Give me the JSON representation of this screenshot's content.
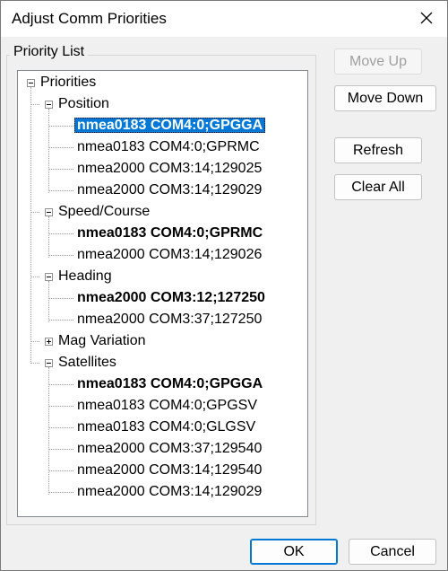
{
  "window": {
    "title": "Adjust Comm Priorities"
  },
  "group": {
    "label": "Priority List"
  },
  "tree": {
    "root": "Priorities",
    "categories": [
      {
        "label": "Position",
        "items": [
          "nmea0183 COM4:0;GPGGA",
          "nmea0183 COM4:0;GPRMC",
          "nmea2000 COM3:14;129025",
          "nmea2000 COM3:14;129029"
        ]
      },
      {
        "label": "Speed/Course",
        "items": [
          "nmea0183 COM4:0;GPRMC",
          "nmea2000 COM3:14;129026"
        ]
      },
      {
        "label": "Heading",
        "items": [
          "nmea2000 COM3:12;127250",
          "nmea2000 COM3:37;127250"
        ]
      },
      {
        "label": "Mag Variation",
        "items": []
      },
      {
        "label": "Satellites",
        "items": [
          "nmea0183 COM4:0;GPGGA",
          "nmea0183 COM4:0;GPGSV",
          "nmea0183 COM4:0;GLGSV",
          "nmea2000 COM3:37;129540",
          "nmea2000 COM3:14;129540",
          "nmea2000 COM3:14;129029"
        ]
      }
    ]
  },
  "buttons": {
    "move_up": "Move Up",
    "move_down": "Move Down",
    "refresh": "Refresh",
    "clear_all": "Clear All",
    "ok": "OK",
    "cancel": "Cancel"
  },
  "colors": {
    "selection": "#0078d7",
    "default_button_border": "#0078d4"
  }
}
